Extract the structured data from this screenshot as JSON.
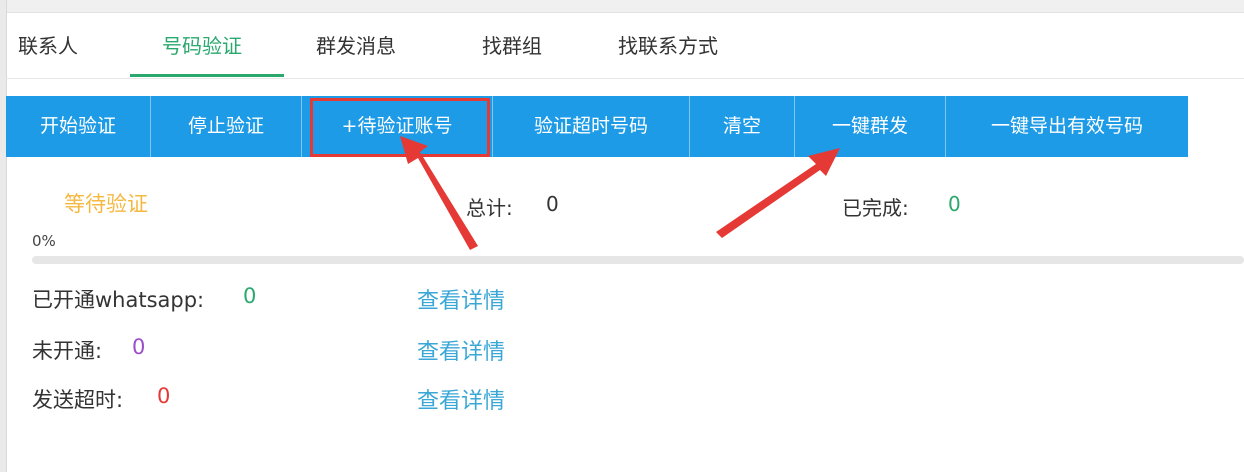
{
  "tabs": [
    {
      "label": "联系人"
    },
    {
      "label": "号码验证"
    },
    {
      "label": "群发消息"
    },
    {
      "label": "找群组"
    },
    {
      "label": "找联系方式"
    }
  ],
  "active_tab": "号码验证",
  "toolbar": {
    "start_verify": "开始验证",
    "stop_verify": "停止验证",
    "add_pending_account": "+待验证账号",
    "verify_timeout_numbers": "验证超时号码",
    "clear": "清空",
    "one_click_broadcast": "一键群发",
    "export_valid_numbers": "一键导出有效号码"
  },
  "status": {
    "state": "等待验证",
    "total_label": "总计:",
    "total_value": "0",
    "done_label": "已完成:",
    "done_value": "0",
    "progress_text": "0%",
    "progress_fraction": 0
  },
  "results": [
    {
      "label": "已开通whatsapp:",
      "value": "0",
      "value_color": "#2aa86e",
      "link": "查看详情"
    },
    {
      "label": "未开通:",
      "value": "0",
      "value_color": "#9b4dca",
      "link": "查看详情"
    },
    {
      "label": "发送超时:",
      "value": "0",
      "value_color": "#e53935",
      "link": "查看详情"
    }
  ],
  "colors": {
    "accent": "#2aa86e",
    "toolbar": "#1e9be6",
    "highlight": "#e53935",
    "waiting": "#f5b942",
    "link": "#3aa7d6"
  }
}
